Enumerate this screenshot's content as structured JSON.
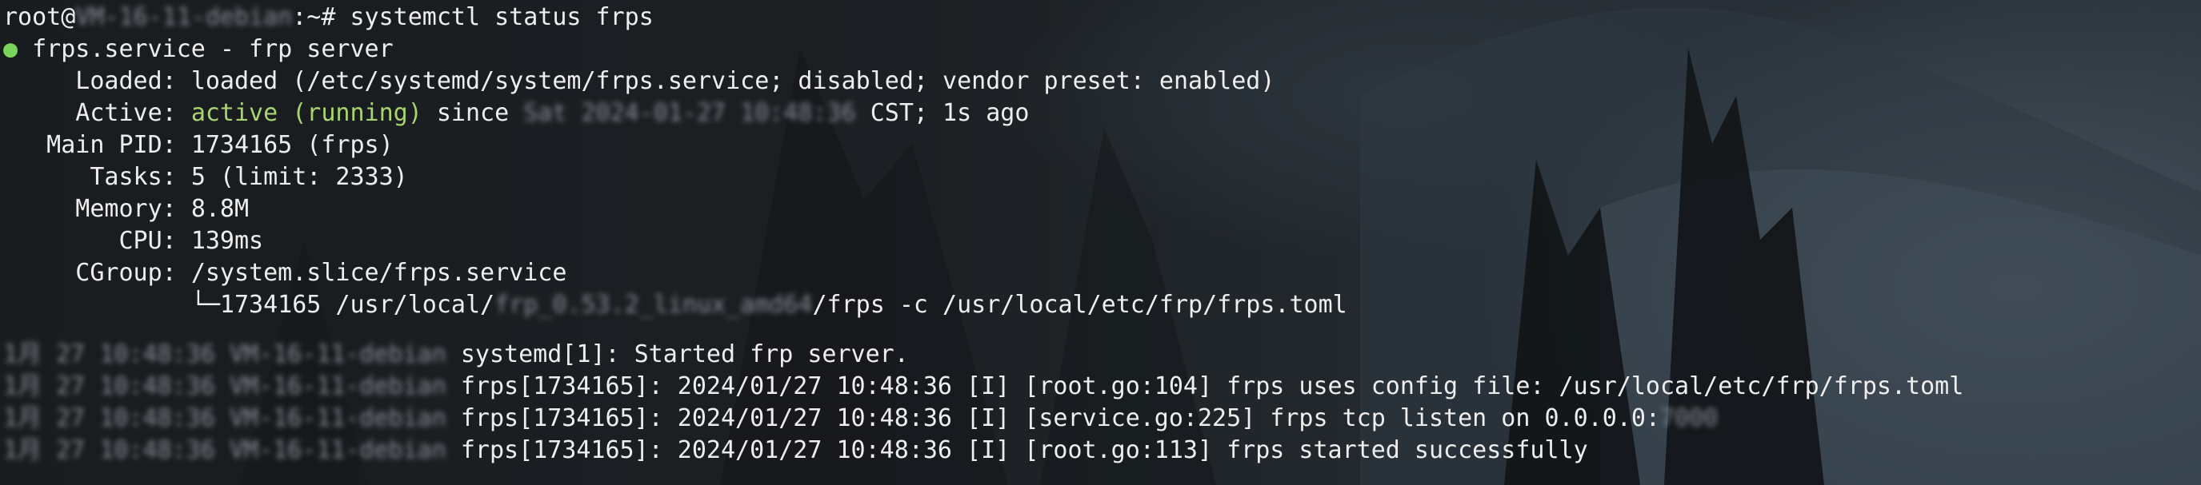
{
  "prompt": {
    "user": "root@",
    "host": "VM-16-11-debian",
    "suffix": ":~# ",
    "command": "systemctl status frps"
  },
  "service": {
    "bullet": "●",
    "title": "frps.service - frp server",
    "loaded_key": "     Loaded: ",
    "loaded_value": "loaded (/etc/systemd/system/frps.service; disabled; vendor preset: enabled)",
    "active_key": "     Active: ",
    "active_state": "active (running)",
    "active_since": " since ",
    "active_time": "Sat 2024-01-27 10:48:36",
    "active_tail": " CST; 1s ago",
    "pid_key": "   Main PID: ",
    "pid_value": "1734165 (frps)",
    "tasks_key": "      Tasks: ",
    "tasks_value": "5 (limit: 2333)",
    "memory_key": "     Memory: ",
    "memory_value": "8.8M",
    "cpu_key": "        CPU: ",
    "cpu_value": "139ms",
    "cgroup_key": "     CGroup: ",
    "cgroup_value": "/system.slice/frps.service",
    "cgroup_child_prefix": "             └─1734165 /usr/local/",
    "cgroup_child_dir": "frp_0.53.2_linux_amd64",
    "cgroup_child_tail": "/frps -c /usr/local/etc/frp/frps.toml"
  },
  "logs": [
    {
      "stamp": "1月 27 10:48:36 VM-16-11-debian",
      "text": " systemd[1]: Started frp server.",
      "hidden": ""
    },
    {
      "stamp": "1月 27 10:48:36 VM-16-11-debian",
      "text": " frps[1734165]: 2024/01/27 10:48:36 [I] [root.go:104] frps uses config file: /usr/local/etc/frp/frps.toml",
      "hidden": ""
    },
    {
      "stamp": "1月 27 10:48:36 VM-16-11-debian",
      "text": " frps[1734165]: 2024/01/27 10:48:36 [I] [service.go:225] frps tcp listen on 0.0.0.0:",
      "hidden": "7000"
    },
    {
      "stamp": "1月 27 10:48:36 VM-16-11-debian",
      "text": " frps[1734165]: 2024/01/27 10:48:36 [I] [root.go:113] frps started successfully",
      "hidden": ""
    }
  ],
  "colors": {
    "text": "#eeeeee",
    "active_green": "#a9d46f",
    "bullet_green": "#7ad35a"
  }
}
